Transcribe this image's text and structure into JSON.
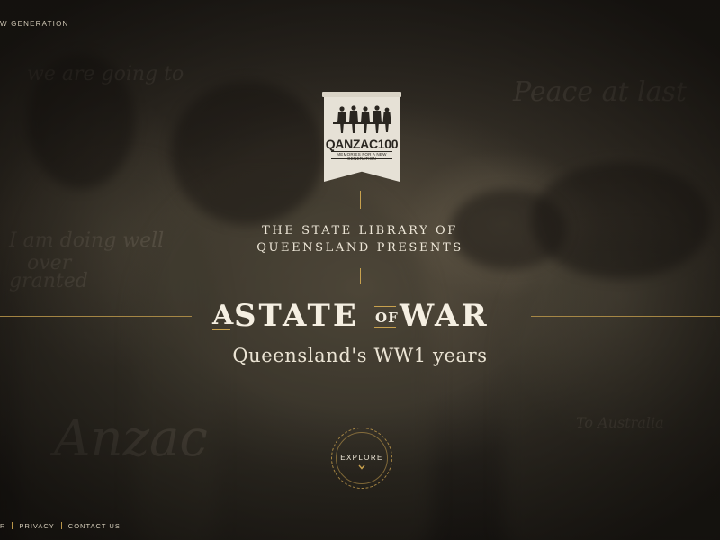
{
  "header": {
    "tagline": "W GENERATION"
  },
  "badge": {
    "name": "QANZAC100",
    "subtitle": "MEMORIES FOR A NEW GENERATION"
  },
  "intro": {
    "line1": "THE STATE LIBRARY OF",
    "line2": "QUEENSLAND PRESENTS"
  },
  "title": {
    "a": "A",
    "state": "STATE",
    "of": "OF",
    "war": "WAR"
  },
  "subtitle": "Queensland's WW1 years",
  "explore": {
    "label": "EXPLORE",
    "icon": "chevron-down-icon"
  },
  "footer": {
    "links": [
      "R",
      "PRIVACY",
      "CONTACT US"
    ]
  },
  "colors": {
    "accent": "#c8a14e",
    "text": "#eee7d8",
    "background": "#2a2620"
  }
}
